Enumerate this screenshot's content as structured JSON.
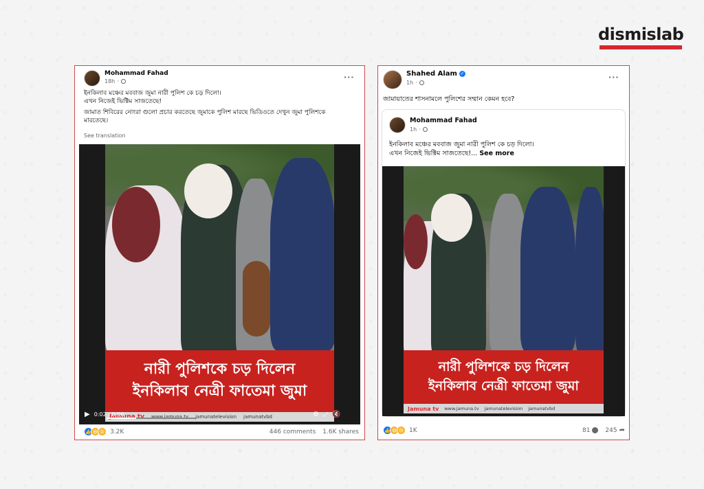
{
  "logo": {
    "text": "dismislab"
  },
  "left_post": {
    "author": "Mohammad Fahad",
    "time": "18h",
    "line1": "ইনকিলাব মঞ্চের মববাজ জুমা নারী পুলিশ কে চড় দিলো।",
    "line2": "এখন নিজেই ভিক্টিম সাজতেছে!",
    "line3": "জামাত শিবিরের নোংরা গুলো প্রচার করতেছে জুমাকে পুলিশ মারছে ভিডিওতে দেখুন জুমা পুলিশকে",
    "line4": "মারতেছে।",
    "see_translation": "See translation",
    "banner_line1": "নারী পুলিশকে চড় দিলেন",
    "banner_line2": "ইনকিলাব নেত্রী ফাতেমা জুমা",
    "video_time": "0:02 / 0:06",
    "ticker_brand": "Jamuna tv",
    "ticker_site": "www.jamuna.tv",
    "ticker_fb": "jamunatelevision",
    "ticker_yt": "jamunatvbd",
    "reaction_count": "3.2K",
    "comments": "446 comments",
    "shares": "1.6K shares",
    "progress": 0.33
  },
  "right_post": {
    "author": "Shahed Alam",
    "time": "1h",
    "text": "জামায়াতের শাসনামলে পুলিশের সম্মান কেমন হবে?",
    "shared_author": "Mohammad Fahad",
    "shared_time": "1h",
    "shared_line1": "ইনকিলাব মঞ্চের মববাজ জুমা নারী পুলিশ কে চড় দিলো।",
    "shared_line2": "এখন নিজেই ভিক্টিম সাজতেছে!...",
    "see_more": "See more",
    "banner_line1": "নারী পুলিশকে চড় দিলেন",
    "banner_line2": "ইনকিলাব নেত্রী ফাতেমা জুমা",
    "ticker_brand": "Jamuna tv",
    "ticker_site": "www.jamuna.tv",
    "ticker_fb": "jamunatelevision",
    "ticker_yt": "jamunatvbd",
    "reaction_count": "1K",
    "comments": "81",
    "shares": "245"
  }
}
